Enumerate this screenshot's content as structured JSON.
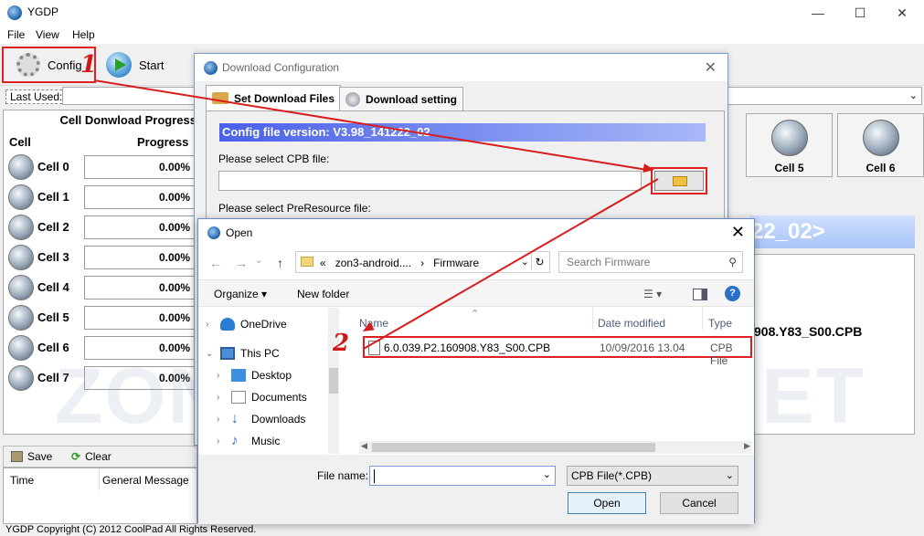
{
  "app": {
    "title": "YGDP"
  },
  "menu": [
    "File",
    "View",
    "Help"
  ],
  "toolbar": {
    "config": "Config",
    "start": "Start"
  },
  "last_used": {
    "label": "Last Used:",
    "value": ""
  },
  "progress_panel": {
    "title": "Cell Donwload Progress",
    "col_cell": "Cell",
    "col_progress": "Progress",
    "cells": [
      {
        "name": "Cell 0",
        "progress": "0.00%"
      },
      {
        "name": "Cell 1",
        "progress": "0.00%"
      },
      {
        "name": "Cell 2",
        "progress": "0.00%"
      },
      {
        "name": "Cell 3",
        "progress": "0.00%"
      },
      {
        "name": "Cell 4",
        "progress": "0.00%"
      },
      {
        "name": "Cell 5",
        "progress": "0.00%"
      },
      {
        "name": "Cell 6",
        "progress": "0.00%"
      },
      {
        "name": "Cell 7",
        "progress": "0.00%"
      }
    ]
  },
  "big_cells": {
    "cell5": "Cell 5",
    "cell6": "Cell 6"
  },
  "blue_strip": "22_02>",
  "right_file": "908.Y83_S00.CPB",
  "watermark": "ZON3-ANDROID.NET",
  "log": {
    "save": "Save",
    "clear": "Clear",
    "col_time": "Time",
    "col_msg": "General Message"
  },
  "status": "YGDP Copyright (C) 2012 CoolPad All Rights Reserved.",
  "download_dialog": {
    "title": "Download Configuration",
    "tab1": "Set Download Files",
    "tab2": "Download setting",
    "version": "Config file version: V3.98_141222_02",
    "cpb_label": "Please select CPB file:",
    "cpb_value": "",
    "preres_label": "Please select PreResource file:"
  },
  "open_dialog": {
    "title": "Open",
    "address": {
      "sep": "«",
      "folder1": "zon3-android....",
      "sep2": "›",
      "folder2": "Firmware"
    },
    "search_placeholder": "Search Firmware",
    "organize": "Organize ▾",
    "new_folder": "New folder",
    "nav": [
      {
        "label": "OneDrive"
      },
      {
        "label": "This PC"
      },
      {
        "label": "Desktop"
      },
      {
        "label": "Documents"
      },
      {
        "label": "Downloads"
      },
      {
        "label": "Music"
      }
    ],
    "columns": {
      "name": "Name",
      "date": "Date modified",
      "type": "Type"
    },
    "file": {
      "name": "6.0.039.P2.160908.Y83_S00.CPB",
      "date": "10/09/2016 13.04",
      "type": "CPB File"
    },
    "file_name_label": "File name:",
    "file_name_value": "",
    "file_type": "CPB File(*.CPB)",
    "open_btn": "Open",
    "cancel_btn": "Cancel"
  },
  "annotations": {
    "step1": "1",
    "step2": "2"
  },
  "colors": {
    "annotation_red": "#d81c1c",
    "version_bar": "#4a60e8"
  }
}
